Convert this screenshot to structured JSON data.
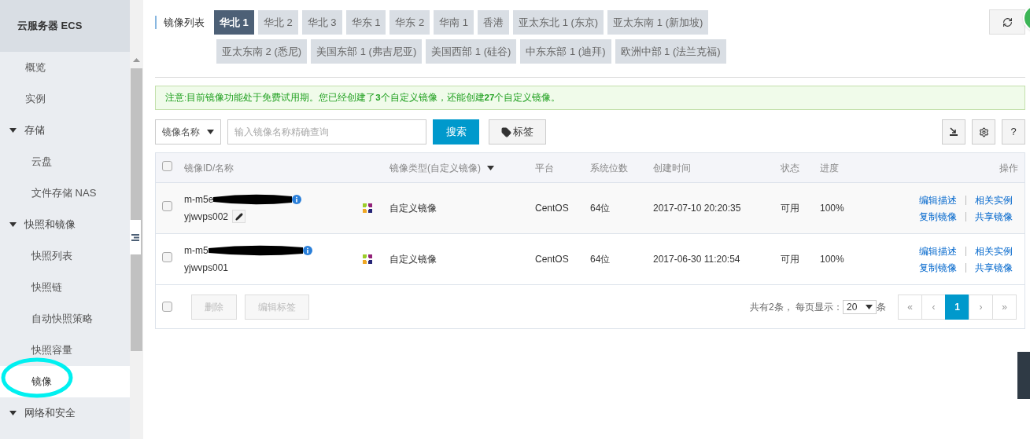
{
  "sidebar": {
    "title": "云服务器 ECS",
    "items": [
      {
        "kind": "item",
        "label": "概览",
        "selected": false
      },
      {
        "kind": "item",
        "label": "实例",
        "selected": false
      },
      {
        "kind": "group",
        "label": "存储",
        "expanded": true,
        "children": [
          {
            "label": "云盘",
            "selected": false
          },
          {
            "label": "文件存储 NAS",
            "selected": false
          }
        ]
      },
      {
        "kind": "group",
        "label": "快照和镜像",
        "expanded": true,
        "children": [
          {
            "label": "快照列表",
            "selected": false
          },
          {
            "label": "快照链",
            "selected": false
          },
          {
            "label": "自动快照策略",
            "selected": false
          },
          {
            "label": "快照容量",
            "selected": false
          },
          {
            "label": "镜像",
            "selected": true
          }
        ]
      },
      {
        "kind": "group",
        "label": "网络和安全",
        "expanded": true
      }
    ]
  },
  "regions": {
    "label": "镜像列表",
    "tabs": [
      {
        "label": "华北 1",
        "selected": true
      },
      {
        "label": "华北 2",
        "selected": false
      },
      {
        "label": "华北 3",
        "selected": false
      },
      {
        "label": "华东 1",
        "selected": false
      },
      {
        "label": "华东 2",
        "selected": false
      },
      {
        "label": "华南 1",
        "selected": false
      },
      {
        "label": "香港",
        "selected": false
      },
      {
        "label": "亚太东北 1 (东京)",
        "selected": false
      },
      {
        "label": "亚太东南 1 (新加坡)",
        "selected": false
      },
      {
        "label": "亚太东南 2 (悉尼)",
        "selected": false
      },
      {
        "label": "美国东部 1 (弗吉尼亚)",
        "selected": false
      },
      {
        "label": "美国西部 1 (硅谷)",
        "selected": false
      },
      {
        "label": "中东东部 1 (迪拜)",
        "selected": false
      },
      {
        "label": "欧洲中部 1 (法兰克福)",
        "selected": false
      }
    ]
  },
  "notice": "注意:目前镜像功能处于免费试用期。您已经创建了**3**个自定义镜像，还能创建**27**个自定义镜像。",
  "search": {
    "filter": "镜像名称",
    "placeholder": "输入镜像名称精确查询",
    "button": "搜索",
    "tag_button": "标签",
    "help": "?"
  },
  "table": {
    "header_checked": false,
    "columns": [
      "镜像ID/名称",
      "镜像类型(自定义镜像)",
      "平台",
      "系统位数",
      "创建时间",
      "状态",
      "进度",
      "操作"
    ],
    "rows": [
      {
        "id": "m-m5e",
        "name": "yjwvps002",
        "editable": true,
        "type": "自定义镜像",
        "platform": "CentOS",
        "bits": "64位",
        "created": "2017-07-10 20:20:35",
        "status": "可用",
        "progress": "100%",
        "actions": [
          "编辑描述",
          "相关实例",
          "复制镜像",
          "共享镜像"
        ],
        "checked": false
      },
      {
        "id": "m-m5",
        "name": "yjwvps001",
        "editable": false,
        "type": "自定义镜像",
        "platform": "CentOS",
        "bits": "64位",
        "created": "2017-06-30 11:20:54",
        "status": "可用",
        "progress": "100%",
        "actions": [
          "编辑描述",
          "相关实例",
          "复制镜像",
          "共享镜像"
        ],
        "checked": false
      }
    ],
    "footer": {
      "checked": false,
      "buttons": [
        "删除",
        "编辑标签"
      ],
      "total": "共有2条， 每页显示：",
      "page_size": "20",
      "unit": "条",
      "pages": [
        {
          "label": "«",
          "selected": false
        },
        {
          "label": "‹",
          "selected": false
        },
        {
          "label": "1",
          "selected": true
        },
        {
          "label": "›",
          "selected": false
        },
        {
          "label": "»",
          "selected": false
        }
      ]
    }
  }
}
